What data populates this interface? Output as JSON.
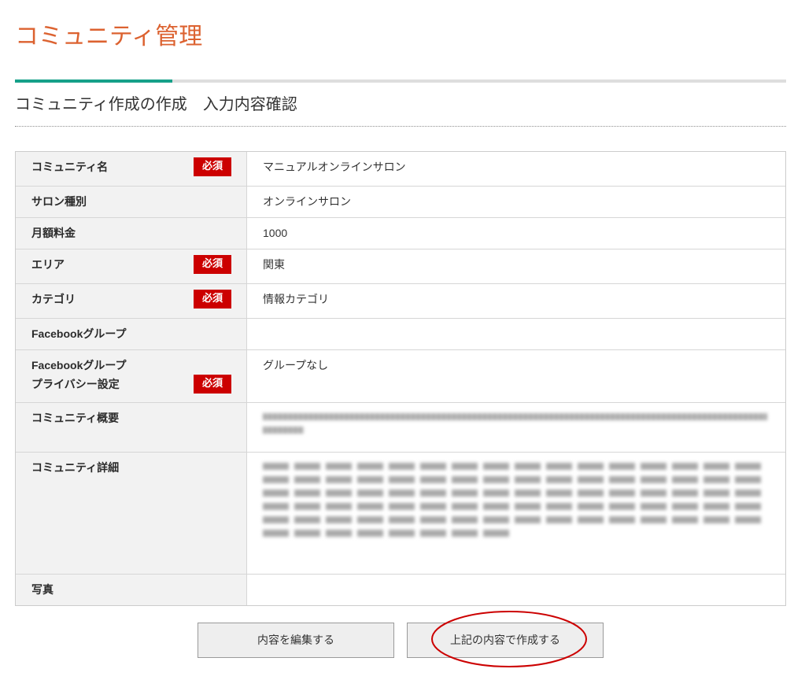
{
  "page": {
    "title": "コミュニティ管理",
    "subtitle": "コミュニティ作成の作成　入力内容確認"
  },
  "colors": {
    "title": "#dc6230",
    "accent": "#16a089",
    "required_badge": "#cc0000",
    "annotation_ellipse": "#cc0000"
  },
  "form": {
    "required_badge": "必須",
    "rows": [
      {
        "label": "コミュニティ名",
        "required": true,
        "value": "マニュアルオンラインサロン"
      },
      {
        "label": "サロン種別",
        "required": false,
        "value": "オンラインサロン"
      },
      {
        "label": "月額料金",
        "required": false,
        "value": "1000"
      },
      {
        "label": "エリア",
        "required": true,
        "value": "関東"
      },
      {
        "label": "カテゴリ",
        "required": true,
        "value": "情報カテゴリ"
      },
      {
        "label": "Facebookグループ",
        "required": false,
        "value": ""
      },
      {
        "label": "Facebookグループ\nプライバシー設定",
        "required": true,
        "value": "グループなし"
      },
      {
        "label": "コミュニティ概要",
        "required": false,
        "value_obscured": true
      },
      {
        "label": "コミュニティ詳細",
        "required": false,
        "value_obscured": true
      },
      {
        "label": "写真",
        "required": false,
        "value": ""
      }
    ]
  },
  "actions": {
    "edit_button": "内容を編集する",
    "submit_button": "上記の内容で作成する"
  }
}
